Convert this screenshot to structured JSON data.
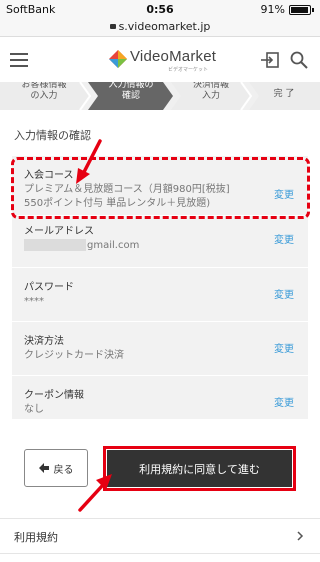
{
  "status_bar": {
    "carrier": "SoftBank",
    "time": "0:56",
    "battery": "91%"
  },
  "browser": {
    "url": "s.videomarket.jp"
  },
  "header": {
    "logo_text": "VideoMarket",
    "logo_sub": "ビデオマーケット"
  },
  "steps": [
    {
      "label": "お客様情報\nの入力",
      "active": false
    },
    {
      "label": "入力情報の\n確認",
      "active": true
    },
    {
      "label": "決済情報\n入力",
      "active": false
    },
    {
      "label": "完 了",
      "active": false
    }
  ],
  "section": {
    "title": "入力情報の確認"
  },
  "rows": {
    "course": {
      "label": "入会コース",
      "value_line1": "プレミアム＆見放題コース（月額980円[税抜]",
      "value_line2": "550ポイント付与 単品レンタル＋見放題)",
      "change": "変更"
    },
    "email": {
      "label": "メールアドレス",
      "value": "gmail.com",
      "change": "変更"
    },
    "password": {
      "label": "パスワード",
      "value": "****",
      "change": "変更"
    },
    "payment": {
      "label": "決済方法",
      "value": "クレジットカード決済",
      "change": "変更"
    },
    "coupon": {
      "label": "クーポン情報",
      "value": "なし",
      "change": "変更"
    }
  },
  "buttons": {
    "back": "戻る",
    "agree": "利用規約に同意して進む"
  },
  "terms": {
    "label": "利用規約"
  },
  "colors": {
    "accent_link": "#3a9bd8",
    "highlight": "#e60012",
    "primary_button": "#333333"
  }
}
